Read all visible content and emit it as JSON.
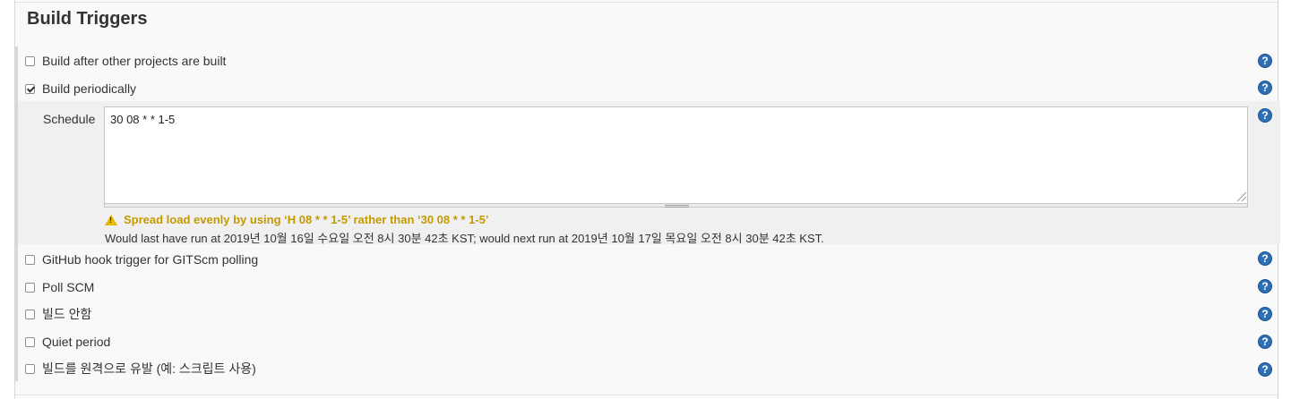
{
  "section": {
    "title": "Build Triggers"
  },
  "triggers": [
    {
      "label": "Build after other projects are built",
      "checked": false
    },
    {
      "label": "Build periodically",
      "checked": true
    },
    {
      "label": "GitHub hook trigger for GITScm polling",
      "checked": false
    },
    {
      "label": "Poll SCM",
      "checked": false
    },
    {
      "label": "빌드 안함",
      "checked": false
    },
    {
      "label": "Quiet period",
      "checked": false
    },
    {
      "label": "빌드를 원격으로 유발 (예: 스크립트 사용)",
      "checked": false
    }
  ],
  "schedule": {
    "label": "Schedule",
    "value": "30 08 * * 1-5",
    "warning": "Spread load evenly by using ‘H 08 * * 1-5’ rather than ‘30 08 * * 1-5’",
    "next_run": "Would last have run at 2019년 10월 16일 수요일 오전 8시 30분 42초 KST; would next run at 2019년 10월 17일 목요일 오전 8시 30분 42초 KST."
  },
  "help_icon": {
    "glyph": "?",
    "icon": "help-icon",
    "color": "#2d6fb5"
  },
  "colors": {
    "warning": "#c49a00",
    "panel": "#f9f9f9",
    "nested_panel": "#f0f0f0"
  }
}
